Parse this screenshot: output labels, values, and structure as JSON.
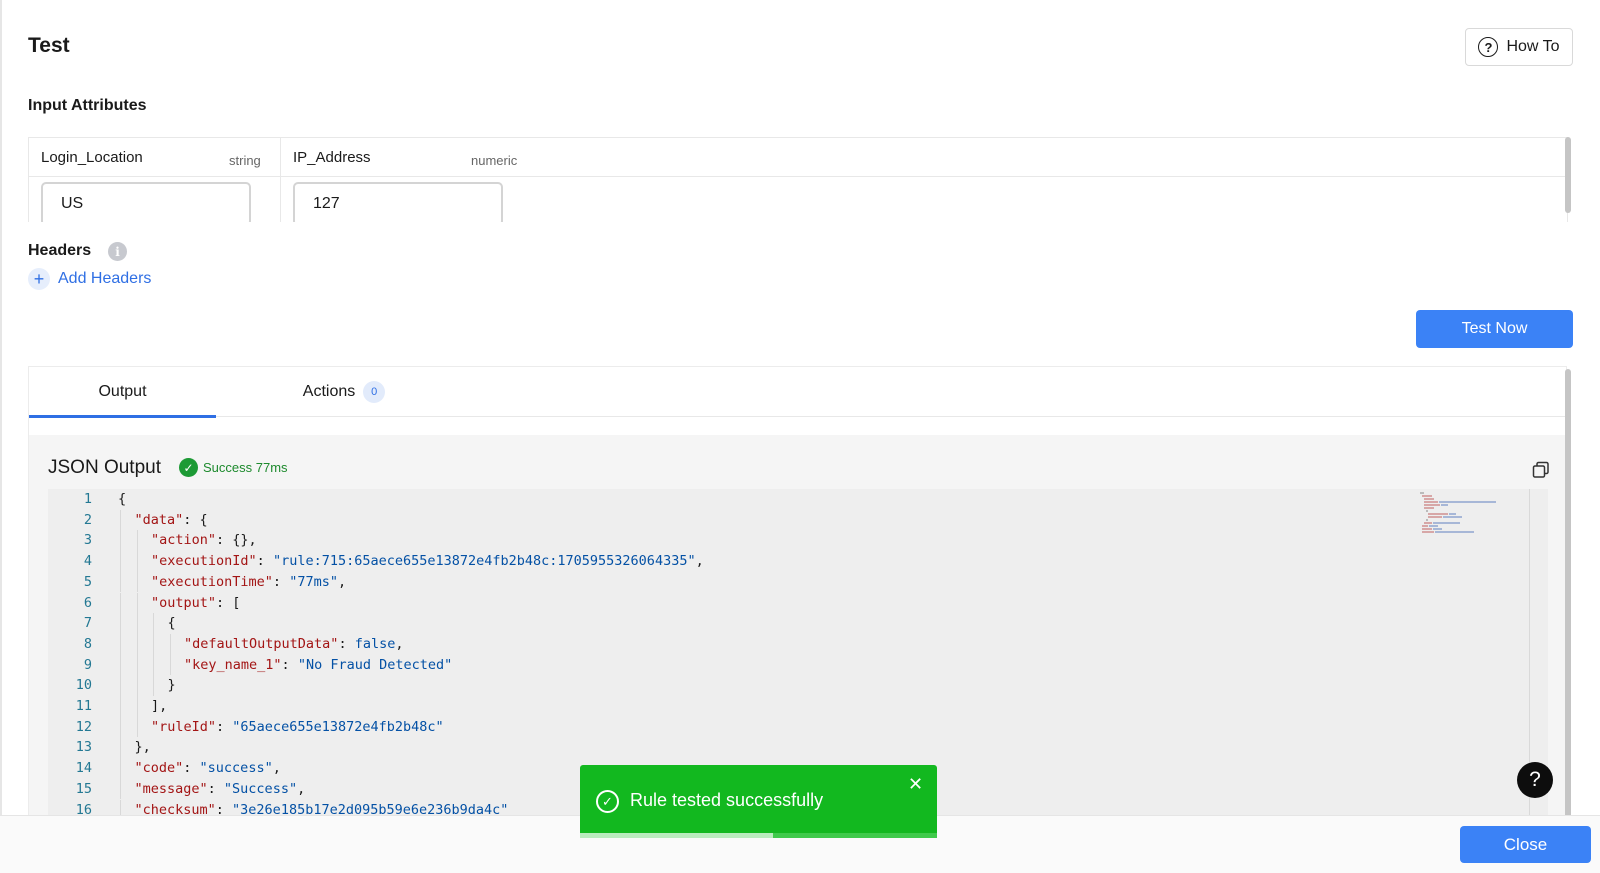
{
  "page": {
    "title": "Test",
    "how_to_label": "How To"
  },
  "input_attributes": {
    "section_label": "Input Attributes",
    "fields": [
      {
        "name": "Login_Location",
        "type": "string",
        "value": "US"
      },
      {
        "name": "IP_Address",
        "type": "numeric",
        "value": "127"
      }
    ]
  },
  "headers": {
    "section_label": "Headers",
    "info_glyph": "i",
    "add_label": "Add Headers",
    "add_glyph": "+"
  },
  "test_button": {
    "label": "Test Now"
  },
  "tabs": [
    {
      "label": "Output",
      "active": true
    },
    {
      "label": "Actions",
      "badge": "0"
    }
  ],
  "json_output": {
    "title": "JSON Output",
    "status_text": "Success 77ms",
    "status_color": "#1d8a2d",
    "lines": [
      {
        "n": "1",
        "indent": 0,
        "parts": [
          [
            "p",
            "{"
          ]
        ]
      },
      {
        "n": "2",
        "indent": 1,
        "parts": [
          [
            "k",
            "\"data\""
          ],
          [
            "p",
            ": {"
          ]
        ]
      },
      {
        "n": "3",
        "indent": 2,
        "parts": [
          [
            "k",
            "\"action\""
          ],
          [
            "p",
            ": {},"
          ]
        ]
      },
      {
        "n": "4",
        "indent": 2,
        "parts": [
          [
            "k",
            "\"executionId\""
          ],
          [
            "p",
            ": "
          ],
          [
            "s",
            "\"rule:715:65aece655e13872e4fb2b48c:1705955326064335\""
          ],
          [
            "p",
            ","
          ]
        ]
      },
      {
        "n": "5",
        "indent": 2,
        "parts": [
          [
            "k",
            "\"executionTime\""
          ],
          [
            "p",
            ": "
          ],
          [
            "s",
            "\"77ms\""
          ],
          [
            "p",
            ","
          ]
        ]
      },
      {
        "n": "6",
        "indent": 2,
        "parts": [
          [
            "k",
            "\"output\""
          ],
          [
            "p",
            ": ["
          ]
        ]
      },
      {
        "n": "7",
        "indent": 3,
        "parts": [
          [
            "p",
            "{"
          ]
        ]
      },
      {
        "n": "8",
        "indent": 4,
        "parts": [
          [
            "k",
            "\"defaultOutputData\""
          ],
          [
            "p",
            ": "
          ],
          [
            "b",
            "false"
          ],
          [
            "p",
            ","
          ]
        ]
      },
      {
        "n": "9",
        "indent": 4,
        "parts": [
          [
            "k",
            "\"key_name_1\""
          ],
          [
            "p",
            ": "
          ],
          [
            "s",
            "\"No Fraud Detected\""
          ]
        ]
      },
      {
        "n": "10",
        "indent": 3,
        "parts": [
          [
            "p",
            "}"
          ]
        ]
      },
      {
        "n": "11",
        "indent": 2,
        "parts": [
          [
            "p",
            "],"
          ]
        ]
      },
      {
        "n": "12",
        "indent": 2,
        "parts": [
          [
            "k",
            "\"ruleId\""
          ],
          [
            "p",
            ": "
          ],
          [
            "s",
            "\"65aece655e13872e4fb2b48c\""
          ]
        ]
      },
      {
        "n": "13",
        "indent": 1,
        "parts": [
          [
            "p",
            "},"
          ]
        ]
      },
      {
        "n": "14",
        "indent": 1,
        "parts": [
          [
            "k",
            "\"code\""
          ],
          [
            "p",
            ": "
          ],
          [
            "s",
            "\"success\""
          ],
          [
            "p",
            ","
          ]
        ]
      },
      {
        "n": "15",
        "indent": 1,
        "parts": [
          [
            "k",
            "\"message\""
          ],
          [
            "p",
            ": "
          ],
          [
            "s",
            "\"Success\""
          ],
          [
            "p",
            ","
          ]
        ]
      },
      {
        "n": "16",
        "indent": 1,
        "parts": [
          [
            "k",
            "\"checksum\""
          ],
          [
            "p",
            ": "
          ],
          [
            "s",
            "\"3e26e185b17e2d095b59e6e236b9da4c\""
          ]
        ]
      }
    ]
  },
  "toast": {
    "message": "Rule tested successfully",
    "progress_fraction": 0.54,
    "color": "#12b81f"
  },
  "help_fab": {
    "glyph": "?"
  },
  "footer": {
    "close_label": "Close"
  },
  "colors": {
    "accent": "#3b82f6",
    "link": "#2f6fe4",
    "json_key": "#a31515",
    "json_string": "#0451a5",
    "line_number": "#237893"
  }
}
